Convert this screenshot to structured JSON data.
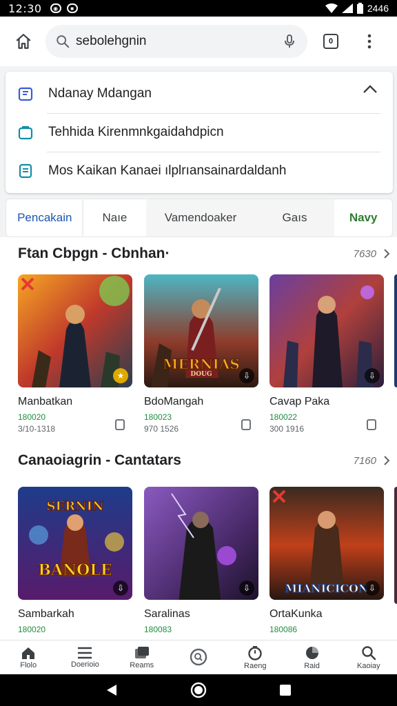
{
  "status_bar": {
    "time": "12:30",
    "right_text": "2446"
  },
  "search": {
    "value": "sebolehgnin"
  },
  "tab_switcher": {
    "count": "0"
  },
  "suggestions": [
    {
      "text": "Ndanay Mdangan"
    },
    {
      "text": "Tehhida Kirenmnkgaidahdpicn"
    },
    {
      "text": "Mos Kaikan Kanaei ılplrıansainardaldanh"
    }
  ],
  "tabs": [
    {
      "label": "Pencakain"
    },
    {
      "label": "Naıe"
    },
    {
      "label": "Vamendoaker"
    },
    {
      "label": "Gaıs"
    },
    {
      "label": "Navy"
    }
  ],
  "sections": [
    {
      "title": "Ftan Cbpgn - Cbnhan·",
      "count": "7630",
      "cards": [
        {
          "title": "Manbatkan",
          "meta1": "180020",
          "meta2": "3/10-1318",
          "thumb_text": ""
        },
        {
          "title": "BdoMangah",
          "meta1": "180023",
          "meta2": "970 1526",
          "thumb_text": "MERNIAS"
        },
        {
          "title": "Cavap Paka",
          "meta1": "180022",
          "meta2": "300 1916",
          "thumb_text": ""
        }
      ]
    },
    {
      "title": "Canaoiagrin - Cantatars",
      "count": "7160",
      "cards": [
        {
          "title": "Sambarkah",
          "meta1": "180020",
          "meta2": "",
          "thumb_text": "BANOLE"
        },
        {
          "title": "Saralinas",
          "meta1": "180083",
          "meta2": "",
          "thumb_text": ""
        },
        {
          "title": "OrtaKunka",
          "meta1": "180086",
          "meta2": "",
          "thumb_text": "MIANICICON"
        }
      ]
    }
  ],
  "thumb_top_texts": {
    "s2c1": "SERNIN",
    "s1c2_sub": "DOUG"
  },
  "bottom_nav": [
    {
      "label": "Flolo",
      "icon": "home-icon"
    },
    {
      "label": "Doerioio",
      "icon": "menu-icon"
    },
    {
      "label": "Reams",
      "icon": "library-icon"
    },
    {
      "label": "",
      "icon": "search-circle-icon"
    },
    {
      "label": "Raeng",
      "icon": "timer-icon"
    },
    {
      "label": "Raid",
      "icon": "pie-icon"
    },
    {
      "label": "Kaoiay",
      "icon": "magnify-icon"
    }
  ],
  "colors": {
    "accent_blue": "#1a56b0",
    "accent_green": "#1e8e3e"
  }
}
